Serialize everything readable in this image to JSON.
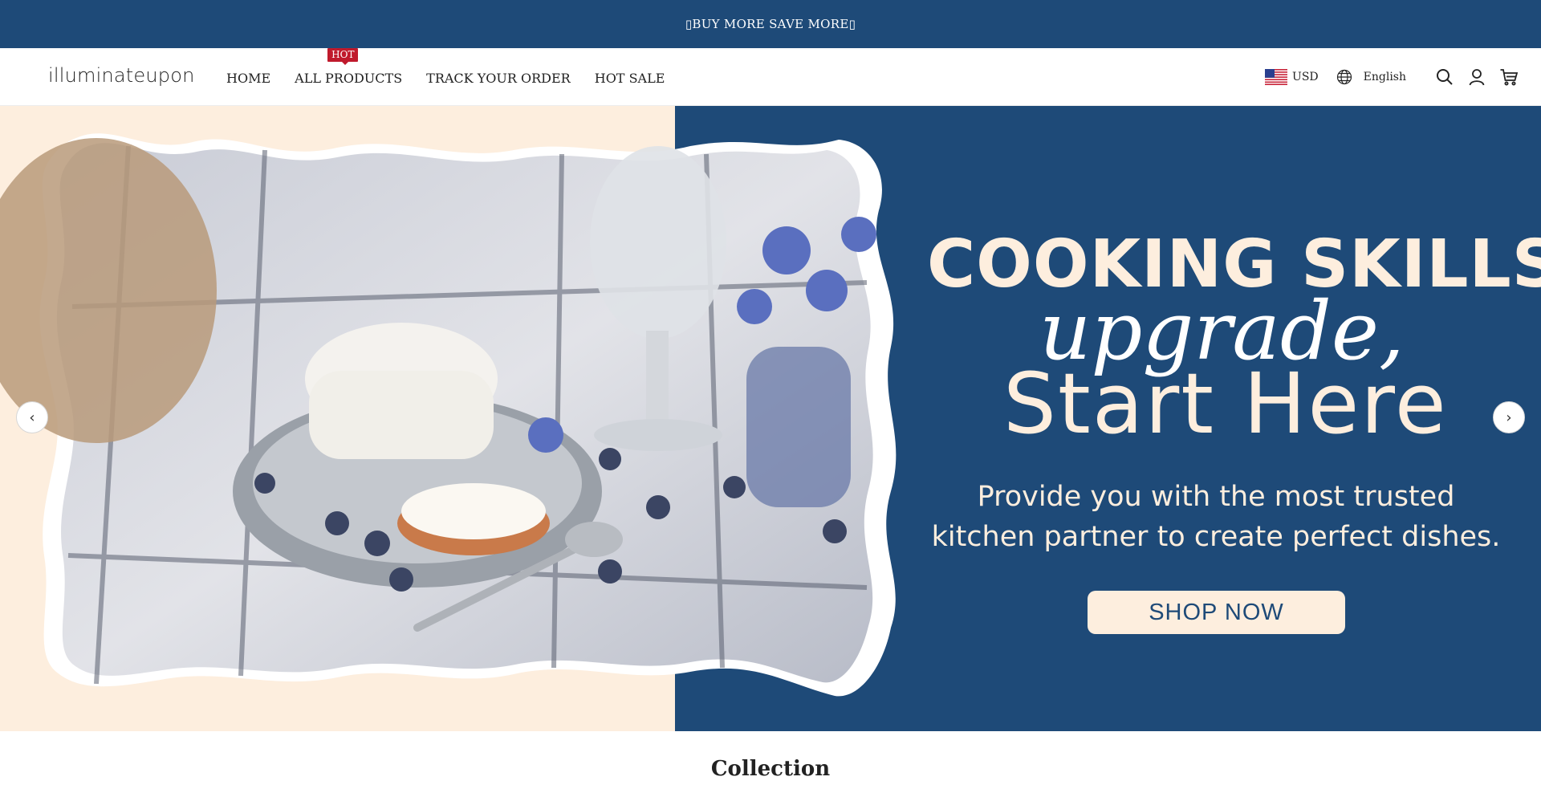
{
  "announcement": {
    "text": "▯BUY MORE SAVE MORE▯"
  },
  "header": {
    "logo": "illuminateupon",
    "nav": [
      {
        "label": "HOME"
      },
      {
        "label": "ALL PRODUCTS",
        "badge": "HOT"
      },
      {
        "label": "TRACK YOUR ORDER"
      },
      {
        "label": "HOT SALE"
      }
    ],
    "currency": "USD",
    "language": "English",
    "icons": [
      "search-icon",
      "account-icon",
      "cart-icon"
    ]
  },
  "hero": {
    "title": "COOKING SKILLS",
    "script": "upgrade,",
    "start": "Start Here",
    "subtitle_line1": "Provide you with the most trusted",
    "subtitle_line2": "kitchen partner to create perfect dishes.",
    "cta": "SHOP NOW",
    "colors": {
      "navy": "#1e4a78",
      "cream": "#fdeede"
    }
  },
  "collection": {
    "title": "Collection"
  },
  "colors": {
    "announcement_bg": "#1e4a78",
    "badge_red": "#c01a2c"
  }
}
